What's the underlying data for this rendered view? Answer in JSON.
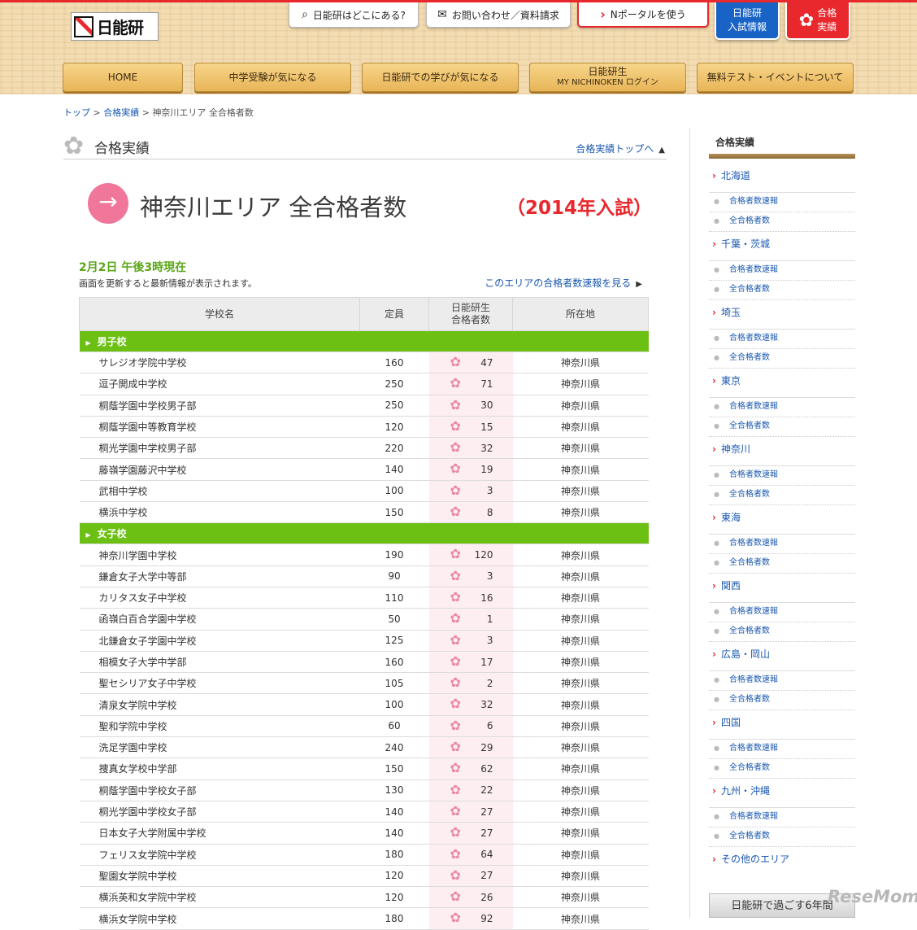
{
  "header": {
    "logo": "日能研",
    "top_links": [
      "日能研はどこにある?",
      "お問い合わせ／資料請求",
      "Nポータルを使う"
    ],
    "blue_btn": [
      "日能研",
      "入試情報"
    ],
    "pink_btn": [
      "合格",
      "実績"
    ],
    "nav": [
      "HOME",
      "中学受験が気になる",
      "日能研での学びが気になる",
      "日能研生",
      "MY NICHINOKEN ログイン",
      "無料テスト・イベントについて"
    ]
  },
  "breadcrumb": [
    "トップ",
    "合格実績",
    "神奈川エリア 全合格者数"
  ],
  "section": {
    "title": "合格実績",
    "top_link": "合格実績トップへ"
  },
  "page": {
    "heading": "神奈川エリア 全合格者数",
    "year": "（2014年入試）",
    "date": "2月2日 午後3時現在",
    "note": "画面を更新すると最新情報が表示されます。",
    "speed_link": "このエリアの合格者数速報を見る"
  },
  "table": {
    "headers": [
      "学校名",
      "定員",
      "日能研生",
      "合格者数",
      "所在地"
    ],
    "groups": [
      {
        "name": "男子校",
        "rows": [
          [
            "サレジオ学院中学校",
            "160",
            "47",
            "神奈川県"
          ],
          [
            "逗子開成中学校",
            "250",
            "71",
            "神奈川県"
          ],
          [
            "桐蔭学園中学校男子部",
            "250",
            "30",
            "神奈川県"
          ],
          [
            "桐蔭学園中等教育学校",
            "120",
            "15",
            "神奈川県"
          ],
          [
            "桐光学園中学校男子部",
            "220",
            "32",
            "神奈川県"
          ],
          [
            "藤嶺学園藤沢中学校",
            "140",
            "19",
            "神奈川県"
          ],
          [
            "武相中学校",
            "100",
            "3",
            "神奈川県"
          ],
          [
            "横浜中学校",
            "150",
            "8",
            "神奈川県"
          ]
        ]
      },
      {
        "name": "女子校",
        "rows": [
          [
            "神奈川学園中学校",
            "190",
            "120",
            "神奈川県"
          ],
          [
            "鎌倉女子大学中等部",
            "90",
            "3",
            "神奈川県"
          ],
          [
            "カリタス女子中学校",
            "110",
            "16",
            "神奈川県"
          ],
          [
            "函嶺白百合学園中学校",
            "50",
            "1",
            "神奈川県"
          ],
          [
            "北鎌倉女子学園中学校",
            "125",
            "3",
            "神奈川県"
          ],
          [
            "相模女子大学中学部",
            "160",
            "17",
            "神奈川県"
          ],
          [
            "聖セシリア女子中学校",
            "105",
            "2",
            "神奈川県"
          ],
          [
            "清泉女学院中学校",
            "100",
            "32",
            "神奈川県"
          ],
          [
            "聖和学院中学校",
            "60",
            "6",
            "神奈川県"
          ],
          [
            "洗足学園中学校",
            "240",
            "29",
            "神奈川県"
          ],
          [
            "捜真女学校中学部",
            "150",
            "62",
            "神奈川県"
          ],
          [
            "桐蔭学園中学校女子部",
            "130",
            "22",
            "神奈川県"
          ],
          [
            "桐光学園中学校女子部",
            "140",
            "27",
            "神奈川県"
          ],
          [
            "日本女子大学附属中学校",
            "140",
            "27",
            "神奈川県"
          ],
          [
            "フェリス女学院中学校",
            "180",
            "64",
            "神奈川県"
          ],
          [
            "聖園女学院中学校",
            "120",
            "27",
            "神奈川県"
          ],
          [
            "横浜英和女学院中学校",
            "120",
            "26",
            "神奈川県"
          ],
          [
            "横浜女学院中学校",
            "180",
            "92",
            "神奈川県"
          ]
        ]
      }
    ]
  },
  "sidebar": {
    "title": "合格実績",
    "regions": [
      "北海道",
      "千葉・茨城",
      "埼玉",
      "東京",
      "神奈川",
      "東海",
      "関西",
      "広島・岡山",
      "四国",
      "九州・沖縄"
    ],
    "sub": [
      "合格者数速報",
      "全合格者数"
    ],
    "other": "その他のエリア",
    "banner": "日能研で過ごす6年間"
  },
  "watermark": "ReseMom"
}
